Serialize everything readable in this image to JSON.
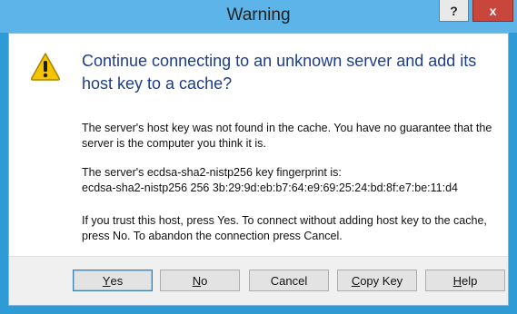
{
  "window": {
    "title": "Warning",
    "help_glyph": "?",
    "close_glyph": "x"
  },
  "message": {
    "icon": "warning-icon",
    "headline": "Continue connecting to an unknown server and add its host key to a cache?",
    "para1": "The server's host key was not found in the cache. You have no guarantee that the server is the computer you think it is.",
    "para2_line1": "The server's ecdsa-sha2-nistp256 key fingerprint is:",
    "para2_line2": "ecdsa-sha2-nistp256 256 3b:29:9d:eb:b7:64:e9:69:25:24:bd:8f:e7:be:11:d4",
    "para3": "If you trust this host, press Yes. To connect without adding host key to the cache, press No. To abandon the connection press Cancel."
  },
  "buttons": {
    "yes_mnemonic": "Y",
    "yes_rest": "es",
    "no_mnemonic": "N",
    "no_rest": "o",
    "cancel": "Cancel",
    "copy_mnemonic": "C",
    "copy_rest": "opy Key",
    "help_mnemonic": "H",
    "help_rest": "elp"
  },
  "colors": {
    "titlebar": "#5cb4e8",
    "frame": "#2e9ad6",
    "close": "#c9463d",
    "headline": "#1e3d8c",
    "warning_fill": "#f5c400"
  }
}
